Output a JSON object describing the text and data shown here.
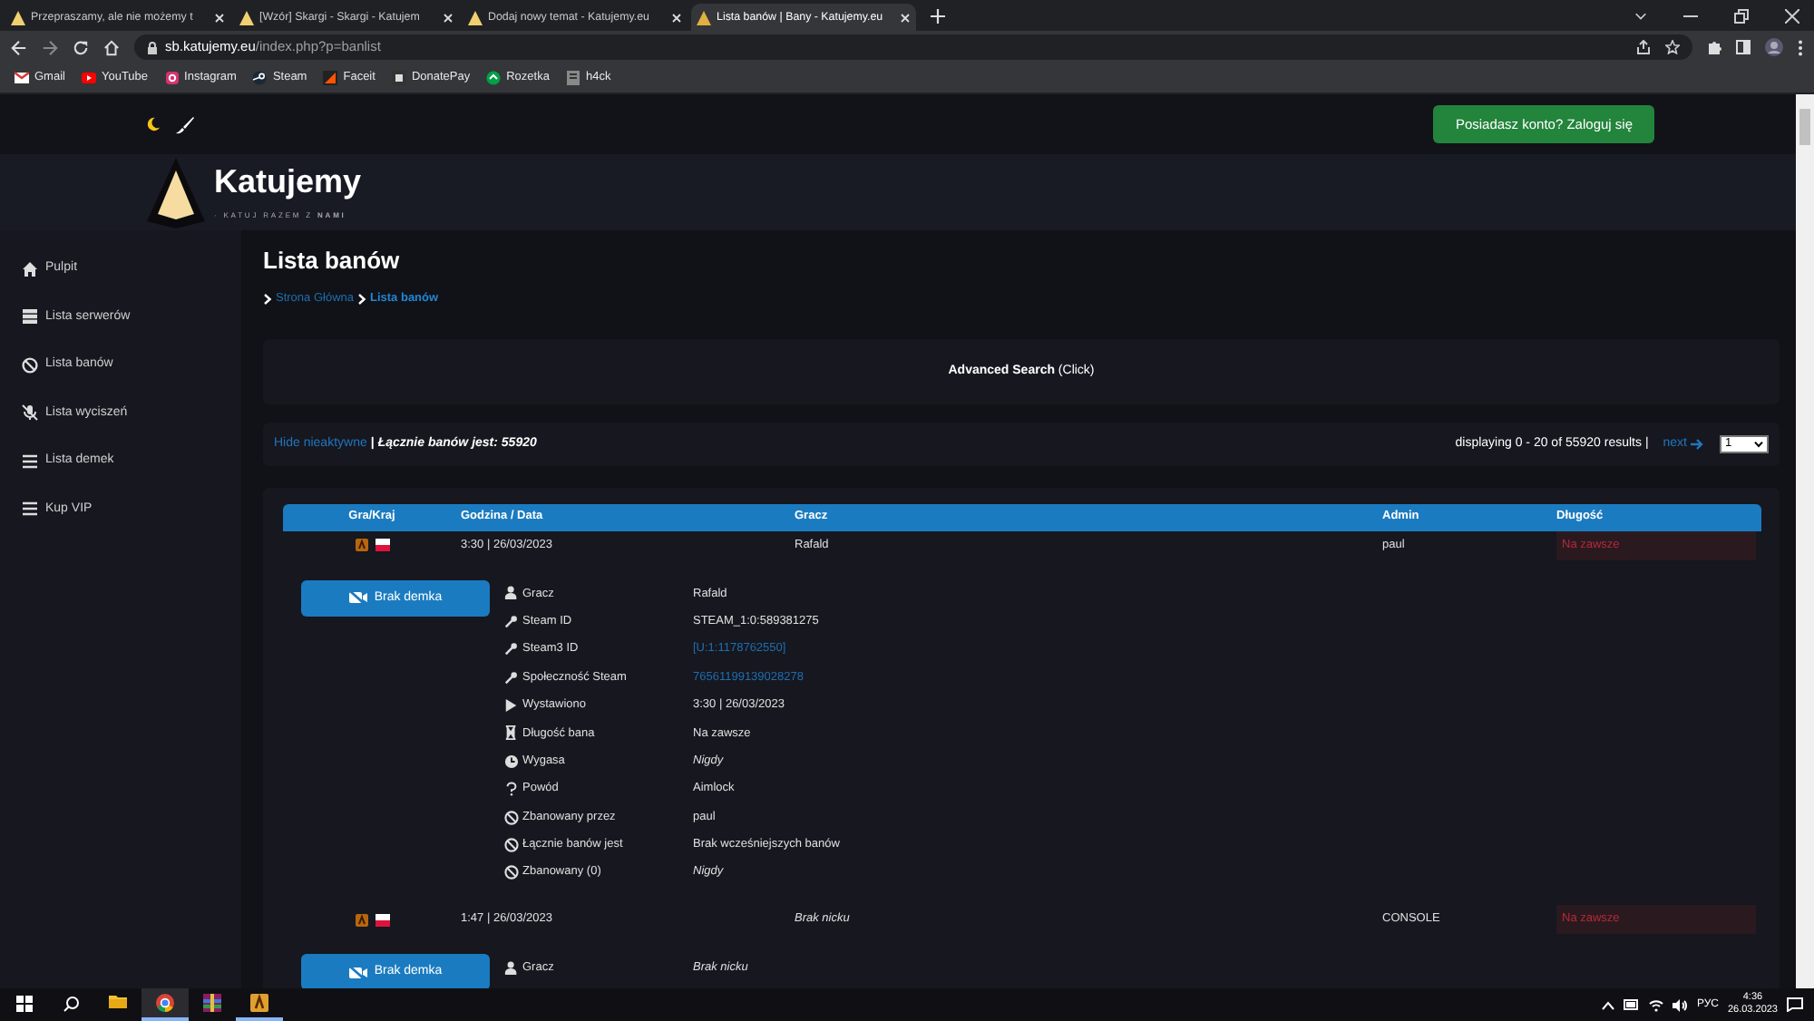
{
  "browser": {
    "tabs": [
      {
        "title": "Przepraszamy, ale nie możemy t",
        "selected": false
      },
      {
        "title": "[Wzór] Skargi - Skargi - Katujem",
        "selected": false
      },
      {
        "title": "Dodaj nowy temat - Katujemy.eu",
        "selected": false
      },
      {
        "title": "Lista banów | Bany - Katujemy.eu",
        "selected": true
      }
    ],
    "url": {
      "host": "sb.katujemy.eu",
      "path": "/index.php?p=banlist"
    },
    "bookmarks": [
      {
        "label": "Gmail",
        "kind": "mail"
      },
      {
        "label": "YouTube",
        "kind": "video"
      },
      {
        "label": "Instagram",
        "kind": "camera"
      },
      {
        "label": "Steam",
        "kind": "steam"
      },
      {
        "label": "Faceit",
        "kind": "faceit"
      },
      {
        "label": "DonatePay",
        "kind": "donate"
      },
      {
        "label": "Rozetka",
        "kind": "shop"
      },
      {
        "label": "h4ck",
        "kind": "page"
      }
    ]
  },
  "site": {
    "login_button": "Posiadasz konto? Zaloguj się",
    "logo": {
      "name": "Katujemy",
      "tagline": "· KATUJ RAZEM Z **NAMI**"
    },
    "sidebar": [
      {
        "label": "Pulpit",
        "kind": "home"
      },
      {
        "label": "Lista serwerów",
        "kind": "servers"
      },
      {
        "label": "Lista banów",
        "kind": "ban"
      },
      {
        "label": "Lista wyciszeń",
        "kind": "mute"
      },
      {
        "label": "Lista demek",
        "kind": "list"
      },
      {
        "label": "Kup VIP",
        "kind": "list"
      }
    ],
    "page_title": "Lista banów",
    "breadcrumb": [
      {
        "label": "Strona Główna",
        "selected": false
      },
      {
        "label": "Lista banów",
        "selected": true
      }
    ],
    "advanced_search": "**Advanced Search** (Click)",
    "info": {
      "hide_link": "Hide nieaktywne",
      "separator": "|",
      "total": "Łącznie banów jest: 55920",
      "displaying": "displaying 0 - 20 of 55920 results |",
      "next": "next",
      "page": "1"
    },
    "table": {
      "columns": [
        "Gra/Kraj",
        "Godzina / Data",
        "Gracz",
        "Admin",
        "Długość"
      ],
      "rows": [
        {
          "time": "3:30 | 26/03/2023",
          "player": "Rafald",
          "player_italic": false,
          "admin": "paul",
          "length": "Na zawsze",
          "demo": "Brak demka",
          "details": [
            {
              "kind": "player",
              "label": "Gracz",
              "value": "Rafald",
              "italic": false,
              "link": false
            },
            {
              "kind": "steam",
              "label": "Steam ID",
              "value": "STEAM_1:0:589381275",
              "italic": false,
              "link": false
            },
            {
              "kind": "steam",
              "label": "Steam3 ID",
              "value": "[U:1:1178762550]",
              "italic": false,
              "link": true
            },
            {
              "kind": "steam",
              "label": "Społeczność Steam",
              "value": "76561199139028278",
              "italic": false,
              "link": true
            },
            {
              "kind": "issued",
              "label": "Wystawiono",
              "value": "3:30 | 26/03/2023",
              "italic": false,
              "link": false
            },
            {
              "kind": "length",
              "label": "Długość bana",
              "value": "Na zawsze",
              "italic": false,
              "link": false
            },
            {
              "kind": "expires",
              "label": "Wygasa",
              "value": "Nigdy",
              "italic": true,
              "link": false
            },
            {
              "kind": "reason",
              "label": "Powód",
              "value": "Aimlock",
              "italic": false,
              "link": false
            },
            {
              "kind": "ban",
              "label": "Zbanowany przez",
              "value": "paul",
              "italic": false,
              "link": false
            },
            {
              "kind": "ban",
              "label": "Łącznie banów jest",
              "value": "Brak wcześniejszych banów",
              "italic": false,
              "link": false
            },
            {
              "kind": "ban",
              "label": "Zbanowany (0)",
              "value": "Nigdy",
              "italic": true,
              "link": false
            }
          ]
        },
        {
          "time": "1:47 | 26/03/2023",
          "player": "Brak nicku",
          "player_italic": true,
          "admin": "CONSOLE",
          "length": "Na zawsze",
          "demo": "Brak demka",
          "details": [
            {
              "kind": "player",
              "label": "Gracz",
              "value": "Brak nicku",
              "italic": true,
              "link": false
            }
          ]
        }
      ]
    }
  },
  "taskbar": {
    "apps": [
      {
        "kind": "explorer",
        "running": false,
        "selected": false
      },
      {
        "kind": "chrome",
        "running": true,
        "selected": true
      },
      {
        "kind": "archive",
        "running": false,
        "selected": false
      },
      {
        "kind": "game",
        "running": true,
        "selected": false
      }
    ],
    "language": "РУС",
    "time": "4:36",
    "date": "26.03.2023"
  }
}
